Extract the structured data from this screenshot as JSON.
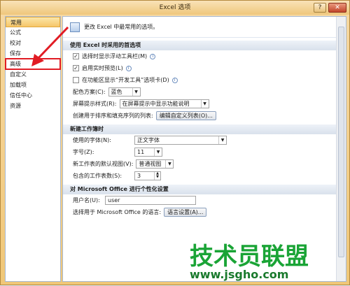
{
  "window": {
    "title": "Excel 选项",
    "min_label": "?",
    "close_label": "✕"
  },
  "sidebar": {
    "items": [
      {
        "label": "常用",
        "active": true
      },
      {
        "label": "公式"
      },
      {
        "label": "校对"
      },
      {
        "label": "保存"
      },
      {
        "label": "高级",
        "highlighted": true
      },
      {
        "label": "自定义"
      },
      {
        "label": "加载项"
      },
      {
        "label": "信任中心"
      },
      {
        "label": "资源"
      }
    ]
  },
  "main": {
    "header_text": "更改 Excel 中最常用的选项。",
    "section1": {
      "title": "使用 Excel 时采用的首选项",
      "opt1": "选择时显示浮动工具栏(M)",
      "opt2": "启用实时预览(L)",
      "opt3": "在功能区显示“开发工具”选项卡(D)",
      "color_label": "配色方案(C):",
      "color_value": "蓝色",
      "tip_label": "屏幕提示样式(R):",
      "tip_value": "在屏幕提示中显示功能说明",
      "list_label": "创建用于排序和填充序列的列表:",
      "list_button": "编辑自定义列表(O)..."
    },
    "section2": {
      "title": "新建工作簿时",
      "font_label": "使用的字体(N):",
      "font_value": "正文字体",
      "size_label": "字号(Z):",
      "size_value": "11",
      "view_label": "新工作表的默认视图(V):",
      "view_value": "普通视图",
      "sheets_label": "包含的工作表数(S):",
      "sheets_value": "3"
    },
    "section3": {
      "title": "对 Microsoft Office 进行个性化设置",
      "user_label": "用户名(U):",
      "user_value": "user",
      "lang_label": "选择用于 Microsoft Office 的语言:",
      "lang_button": "语言设置(A)..."
    }
  },
  "watermark": {
    "big": "技术员联盟",
    "small": "www.jsgho.com"
  },
  "colors": {
    "accent_red": "#e11c24",
    "watermark_green": "#1aa436"
  }
}
